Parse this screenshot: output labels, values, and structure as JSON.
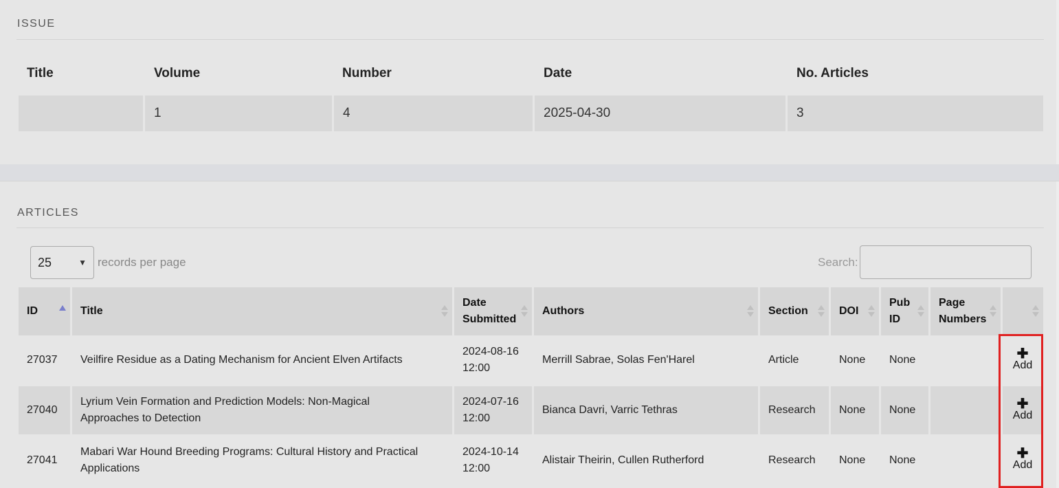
{
  "issue": {
    "heading": "ISSUE",
    "columns": [
      "Title",
      "Volume",
      "Number",
      "Date",
      "No. Articles"
    ],
    "row": {
      "title": "",
      "volume": "1",
      "number": "4",
      "date": "2025-04-30",
      "articles": "3"
    }
  },
  "articles": {
    "heading": "ARTICLES",
    "page_size": "25",
    "records_per_page_label": "records per page",
    "search_label": "Search:",
    "search_value": "",
    "columns": {
      "id": "ID",
      "title": "Title",
      "date_submitted_1": "Date",
      "date_submitted_2": "Submitted",
      "authors": "Authors",
      "section": "Section",
      "doi": "DOI",
      "pubid_1": "Pub",
      "pubid_2": "ID",
      "pages_1": "Page",
      "pages_2": "Numbers"
    },
    "rows": [
      {
        "id": "27037",
        "title": "Veilfire Residue as a Dating Mechanism for Ancient Elven Artifacts",
        "date": "2024-08-16",
        "time": "12:00",
        "authors": "Merrill Sabrae, Solas Fen'Harel",
        "section": "Article",
        "doi": "None",
        "pubid": "None",
        "pages": "",
        "action": "Add"
      },
      {
        "id": "27040",
        "title_1": "Lyrium Vein Formation and Prediction Models: Non-Magical",
        "title_2": "Approaches to Detection",
        "date": "2024-07-16",
        "time": "12:00",
        "authors": "Bianca Davri, Varric Tethras",
        "section": "Research",
        "doi": "None",
        "pubid": "None",
        "pages": "",
        "action": "Add"
      },
      {
        "id": "27041",
        "title_1": "Mabari War Hound Breeding Programs: Cultural History and Practical",
        "title_2": "Applications",
        "date": "2024-10-14",
        "time": "12:00",
        "authors": "Alistair Theirin, Cullen Rutherford",
        "section": "Research",
        "doi": "None",
        "pubid": "None",
        "pages": "",
        "action": "Add"
      }
    ]
  },
  "colors": {
    "highlight": "#e02020",
    "sort_active": "#7a7fcc"
  }
}
